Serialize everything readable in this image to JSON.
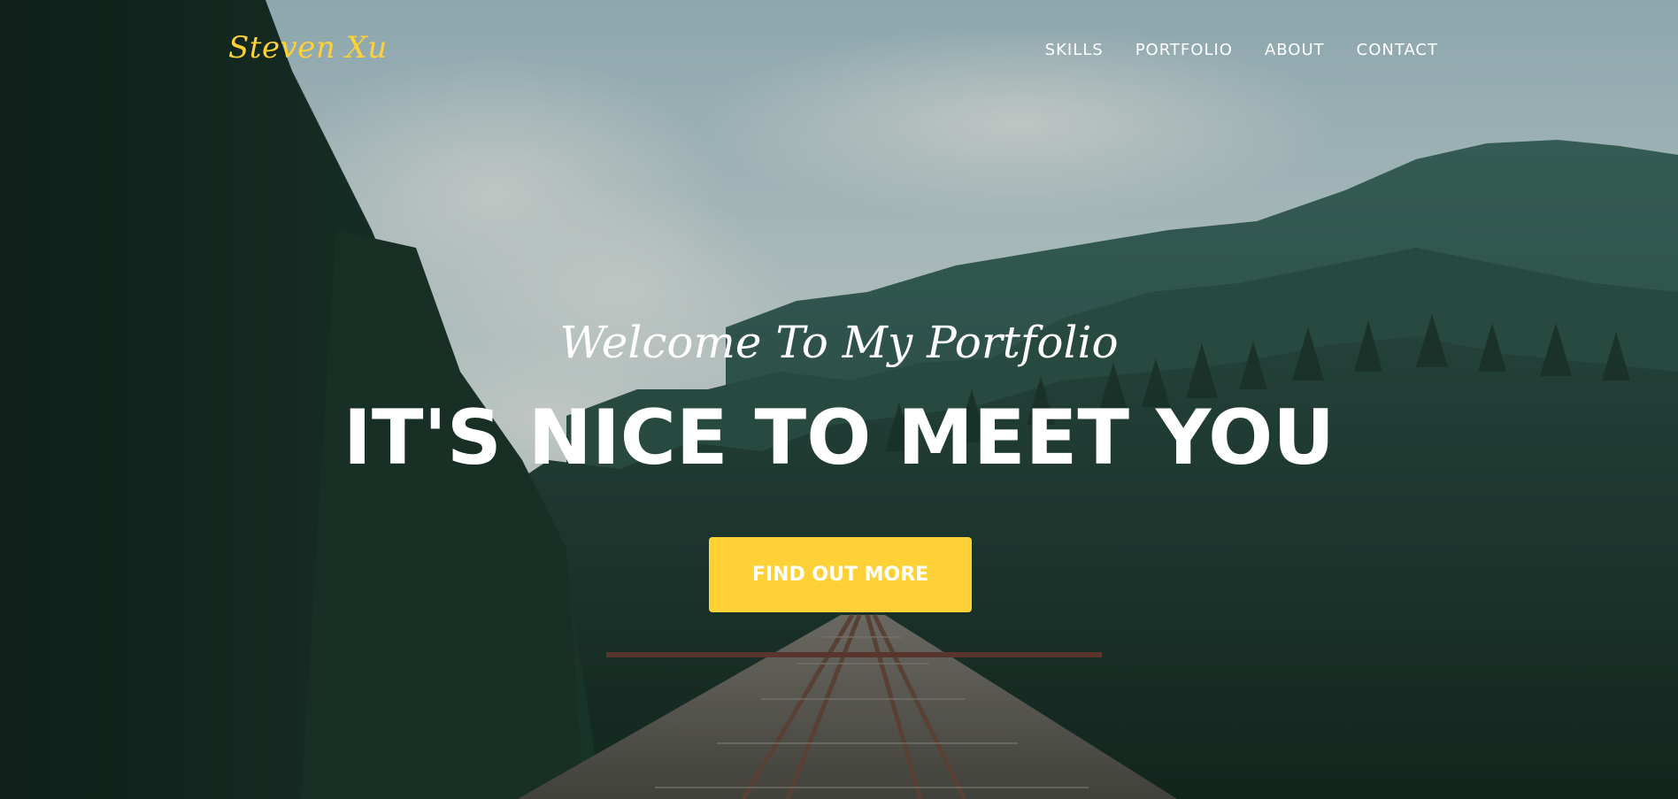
{
  "navbar": {
    "brand": "Steven Xu",
    "links": [
      {
        "label": "SKILLS"
      },
      {
        "label": "PORTFOLIO"
      },
      {
        "label": "ABOUT"
      },
      {
        "label": "CONTACT"
      }
    ]
  },
  "intro": {
    "lead_in": "Welcome To My Portfolio",
    "heading": "IT'S NICE TO MEET YOU",
    "button_label": "FIND OUT MORE"
  },
  "colors": {
    "accent": "#fed136",
    "text": "#ffffff"
  },
  "background": {
    "description_icon": "forest-railway-bridge-photo"
  }
}
